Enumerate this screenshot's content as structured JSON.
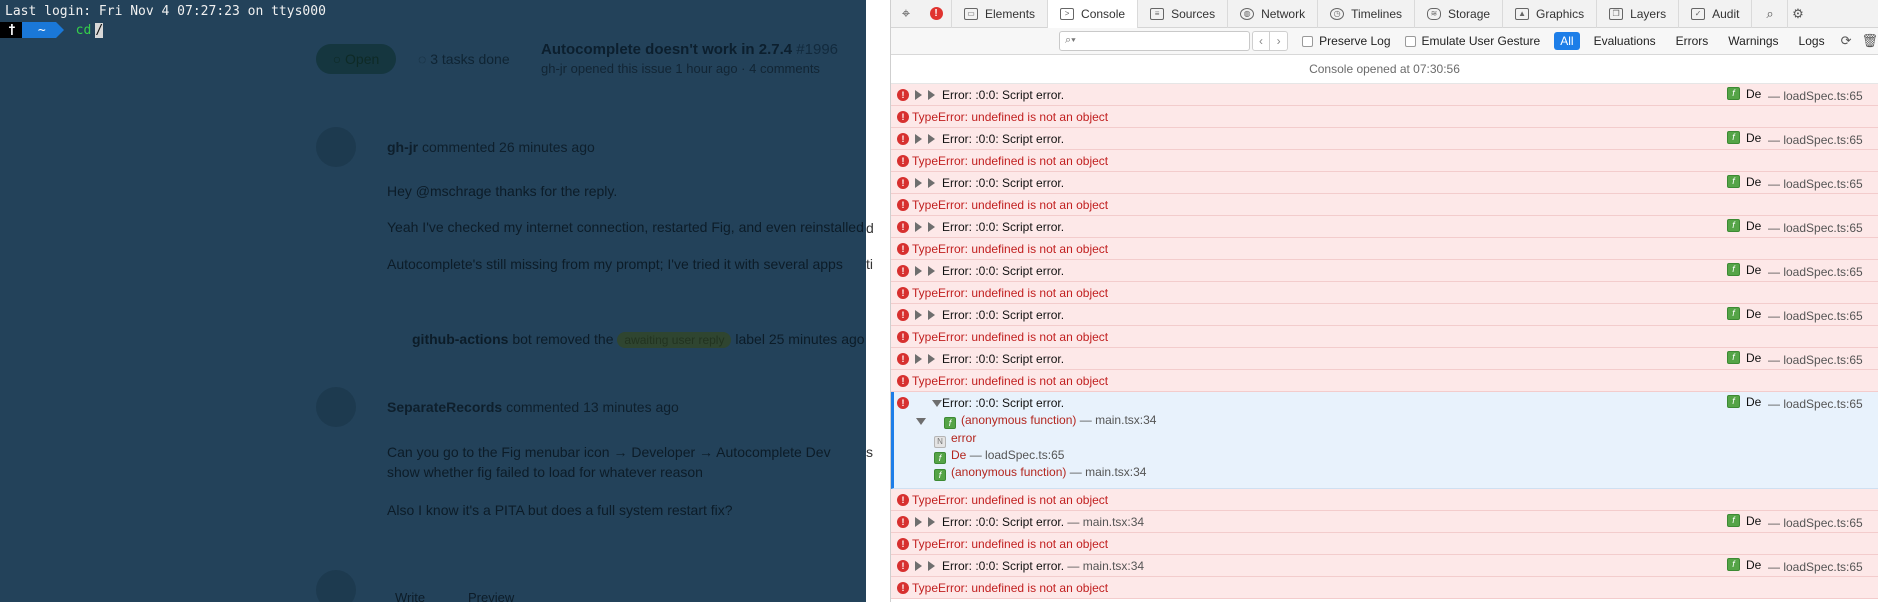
{
  "terminal": {
    "login_line": "Last login: Fri Nov  4 07:27:23 on ttys000",
    "prompt_home_glyph": "†",
    "prompt_dir": "~",
    "command": "cd ",
    "cursor_char": "/"
  },
  "background_page": {
    "status_label": "Open",
    "tasks_label": "3 tasks done",
    "issue_title": "Autocomplete doesn't work in 2.7.4",
    "issue_number": "#1996",
    "issue_meta": "gh-jr opened this issue 1 hour ago · 4 comments",
    "comment1_author": "gh-jr",
    "comment1_meta": "commented 26 minutes ago",
    "comment1_p1": "Hey @mschrage thanks for the reply.",
    "comment1_p2": "Yeah I've checked my internet connection, restarted Fig, and even reinstalled",
    "comment1_p3": "Autocomplete's still missing from my prompt; I've tried it with several apps",
    "event_actor": "github-actions",
    "event_bot": "bot",
    "event_text": "removed the",
    "event_label": "awaiting user reply",
    "event_time": "label 25 minutes ago",
    "comment2_author": "SeparateRecords",
    "comment2_meta": "commented 13 minutes ago",
    "comment2_p1": "Can you go to the Fig menubar icon → Developer → Autocomplete Dev",
    "comment2_p2": "show whether fig failed to load for whatever reason",
    "comment2_p3": "Also I know it's a PITA but does a full system restart fix?",
    "footer_tab1": "Write",
    "footer_tab2": "Preview",
    "seam_chars": [
      "d",
      "ti",
      "s"
    ]
  },
  "inspector": {
    "tabs": [
      {
        "label": "Elements",
        "icon": "elements-icon"
      },
      {
        "label": "Console",
        "icon": "console-icon"
      },
      {
        "label": "Sources",
        "icon": "sources-icon"
      },
      {
        "label": "Network",
        "icon": "network-icon"
      },
      {
        "label": "Timelines",
        "icon": "timelines-icon"
      },
      {
        "label": "Storage",
        "icon": "storage-icon"
      },
      {
        "label": "Graphics",
        "icon": "graphics-icon"
      },
      {
        "label": "Layers",
        "icon": "layers-icon"
      },
      {
        "label": "Audit",
        "icon": "audit-icon"
      }
    ],
    "active_tab": "Console",
    "error_badge": "!",
    "filter": {
      "search_value": "",
      "preserve_log": "Preserve Log",
      "emulate_gesture": "Emulate User Gesture",
      "levels": [
        "All",
        "Evaluations",
        "Errors",
        "Warnings",
        "Logs"
      ],
      "active_level": "All"
    },
    "console_opened": "Console opened at 07:30:56",
    "accent_color": "#1d7ee8",
    "error_color": "#d7302f",
    "entries": {
      "e1": {
        "msg": "Error: :0:0: Script error.",
        "loc": "",
        "type_error": "TypeError: undefined is not an object",
        "func": "De",
        "source": "loadSpec.ts:65"
      },
      "e2": {
        "msg": "Error: :0:0: Script error.",
        "loc": "",
        "type_error": "TypeError: undefined is not an object",
        "func": "De",
        "source": "loadSpec.ts:65"
      },
      "e3": {
        "msg": "Error: :0:0: Script error.",
        "loc": "",
        "type_error": "TypeError: undefined is not an object",
        "func": "De",
        "source": "loadSpec.ts:65"
      },
      "e4": {
        "msg": "Error: :0:0: Script error.",
        "loc": "",
        "type_error": "TypeError: undefined is not an object",
        "func": "De",
        "source": "loadSpec.ts:65"
      },
      "e5": {
        "msg": "Error: :0:0: Script error.",
        "loc": "",
        "type_error": "TypeError: undefined is not an object",
        "func": "De",
        "source": "loadSpec.ts:65"
      },
      "e6": {
        "msg": "Error: :0:0: Script error.",
        "loc": "",
        "type_error": "TypeError: undefined is not an object",
        "func": "De",
        "source": "loadSpec.ts:65"
      },
      "e7": {
        "msg": "Error: :0:0: Script error.",
        "loc": "",
        "type_error": "TypeError: undefined is not an object",
        "func": "De",
        "source": "loadSpec.ts:65"
      },
      "expanded": {
        "msg": "Error: :0:0: Script error.",
        "frame1": "(anonymous function)",
        "frame1_loc": "main.tsx:34",
        "prop_error": "error",
        "frame2": "De",
        "frame2_loc": "loadSpec.ts:65",
        "frame3": "(anonymous function)",
        "frame3_loc": "main.tsx:34",
        "func": "De",
        "source": "loadSpec.ts:65",
        "type_error": "TypeError: undefined is not an object"
      },
      "e8": {
        "msg": "Error: :0:0: Script error.",
        "loc": "main.tsx:34",
        "type_error": "TypeError: undefined is not an object",
        "func": "De",
        "source": "loadSpec.ts:65"
      },
      "e9": {
        "msg": "Error: :0:0: Script error.",
        "loc": "main.tsx:34",
        "type_error": "TypeError: undefined is not an object",
        "func": "De",
        "source": "loadSpec.ts:65"
      }
    }
  }
}
